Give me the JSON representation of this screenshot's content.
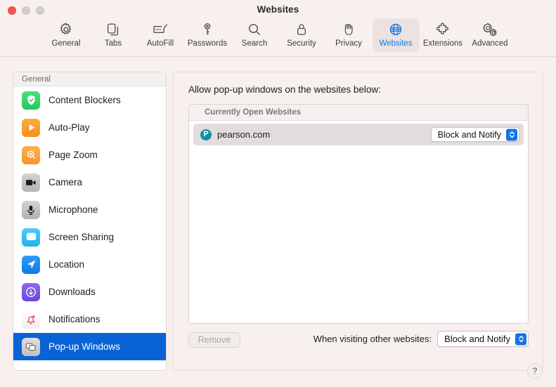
{
  "window": {
    "title": "Websites",
    "controls": [
      {
        "name": "close",
        "color": "#f3544a"
      },
      {
        "name": "minimize",
        "color": "#d2cdcc"
      },
      {
        "name": "zoom",
        "color": "#d2cdcc"
      }
    ]
  },
  "toolbar": {
    "items": [
      {
        "label": "General",
        "icon": "gear-icon",
        "selected": false
      },
      {
        "label": "Tabs",
        "icon": "tabs-icon",
        "selected": false
      },
      {
        "label": "AutoFill",
        "icon": "autofill-icon",
        "selected": false
      },
      {
        "label": "Passwords",
        "icon": "key-icon",
        "selected": false
      },
      {
        "label": "Search",
        "icon": "search-icon",
        "selected": false
      },
      {
        "label": "Security",
        "icon": "lock-icon",
        "selected": false
      },
      {
        "label": "Privacy",
        "icon": "hand-icon",
        "selected": false
      },
      {
        "label": "Websites",
        "icon": "globe-icon",
        "selected": true
      },
      {
        "label": "Extensions",
        "icon": "puzzle-icon",
        "selected": false
      },
      {
        "label": "Advanced",
        "icon": "gears-icon",
        "selected": false
      }
    ]
  },
  "sidebar": {
    "header": "General",
    "items": [
      {
        "label": "Content Blockers",
        "icon": "shield-check-icon",
        "selected": false
      },
      {
        "label": "Auto-Play",
        "icon": "play-icon",
        "selected": false
      },
      {
        "label": "Page Zoom",
        "icon": "magnifier-plus-icon",
        "selected": false
      },
      {
        "label": "Camera",
        "icon": "camera-icon",
        "selected": false
      },
      {
        "label": "Microphone",
        "icon": "microphone-icon",
        "selected": false
      },
      {
        "label": "Screen Sharing",
        "icon": "screen-share-icon",
        "selected": false
      },
      {
        "label": "Location",
        "icon": "location-arrow-icon",
        "selected": false
      },
      {
        "label": "Downloads",
        "icon": "download-icon",
        "selected": false
      },
      {
        "label": "Notifications",
        "icon": "bell-icon",
        "selected": false
      },
      {
        "label": "Pop-up Windows",
        "icon": "windows-icon",
        "selected": true
      }
    ]
  },
  "panel": {
    "title": "Allow pop-up windows on the websites below:",
    "list_group_header": "Currently Open Websites",
    "sites": [
      {
        "favicon_letter": "P",
        "favicon_color": "#0f8faf",
        "name": "pearson.com",
        "setting": "Block and Notify"
      }
    ],
    "remove_button": "Remove",
    "default_label": "When visiting other websites:",
    "default_setting": "Block and Notify",
    "help_button": "?"
  },
  "colors": {
    "accent": "#0a63d6",
    "popup_chevron": "#1473e6",
    "selected_tab_text": "#0a7cf0",
    "window_background": "#f7f0ef"
  }
}
